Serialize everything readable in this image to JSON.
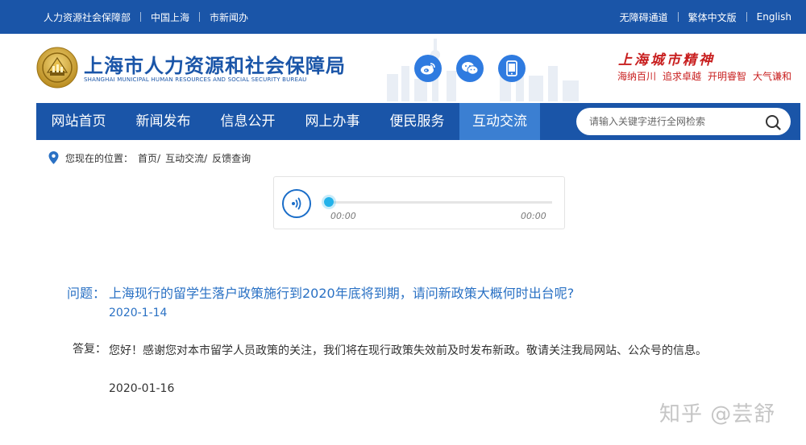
{
  "topbar": {
    "left_links": [
      "人力资源社会保障部",
      "中国上海",
      "市新闻办"
    ],
    "right_links": [
      "无障碍通道",
      "繁体中文版",
      "English"
    ]
  },
  "header": {
    "title": "上海市人力资源和社会保障局",
    "subtitle": "SHANGHAI MUNICIPAL HUMAN RESOURCES AND SOCIAL SECURITY BUREAU",
    "slogan_title": "上海城市精神",
    "slogan_items": [
      "海纳百川",
      "追求卓越",
      "开明睿智",
      "大气谦和"
    ],
    "social_icons": [
      "weibo-icon",
      "wechat-icon",
      "mobile-icon"
    ]
  },
  "nav": {
    "items": [
      "网站首页",
      "新闻发布",
      "信息公开",
      "网上办事",
      "便民服务",
      "互动交流"
    ],
    "active_index": 5,
    "search_placeholder": "请输入关键字进行全网检索"
  },
  "breadcrumb": {
    "label": "您现在的位置：",
    "items": [
      "首页/",
      "互动交流/",
      "反馈查询"
    ]
  },
  "player": {
    "current_time": "00:00",
    "duration": "00:00",
    "progress": 0
  },
  "qa": {
    "question_label": "问题：",
    "question": "上海现行的留学生落户政策施行到2020年底将到期，请问新政策大概何时出台呢?",
    "question_date": "2020-1-14",
    "answer_label": "答复：",
    "answer": "您好！感谢您对本市留学人员政策的关注，我们将在现行政策失效前及时发布新政。敬请关注我局网站、公众号的信息。",
    "answer_date": "2020-01-16"
  },
  "watermark": "知乎 @芸舒",
  "colors": {
    "brand_blue": "#1a55a8",
    "nav_active": "#3b7fd2",
    "question_blue": "#2a71c4",
    "slogan_red": "#c81e1e",
    "progress_cyan": "#22b2ea"
  }
}
